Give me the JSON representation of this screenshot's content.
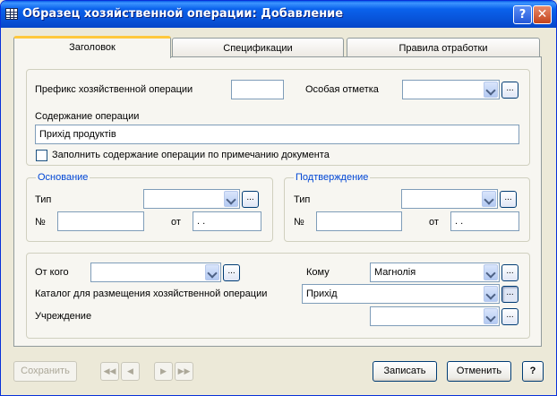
{
  "window": {
    "title": "Образец хозяйственной операции: Добавление"
  },
  "tabs": [
    {
      "label": "Заголовок",
      "active": true
    },
    {
      "label": "Спецификации",
      "active": false
    },
    {
      "label": "Правила отработки",
      "active": false
    }
  ],
  "header_section": {
    "prefix_label": "Префикс хозяйственной операции",
    "prefix_value": "",
    "special_mark_label": "Особая отметка",
    "special_mark_value": "",
    "content_label": "Содержание операции",
    "content_value": "Прихід продуктів",
    "fill_checkbox_label": "Заполнить содержание операции по примечанию документа",
    "fill_checkbox_checked": false
  },
  "basis": {
    "title": "Основание",
    "type_label": "Тип",
    "type_value": "",
    "number_label": "№",
    "number_value": "",
    "date_label": "от",
    "date_value": " . ."
  },
  "confirmation": {
    "title": "Подтверждение",
    "type_label": "Тип",
    "type_value": "",
    "number_label": "№",
    "number_value": "",
    "date_label": "от",
    "date_value": " . ."
  },
  "parties": {
    "from_label": "От кого",
    "from_value": "",
    "to_label": "Кому",
    "to_value": "Магнолія",
    "catalog_label": "Каталог для размещения хозяйственной операции",
    "catalog_value": "Прихід",
    "institution_label": "Учреждение",
    "institution_value": ""
  },
  "footer": {
    "save_label": "Сохранить",
    "nav_first": "◀◀",
    "nav_prev": "◀",
    "nav_next": "▶",
    "nav_last": "▶▶",
    "write_label": "Записать",
    "cancel_label": "Отменить",
    "help_label": "?"
  },
  "icons": {
    "dots": "...",
    "help": "?",
    "close": "✕"
  },
  "colors": {
    "titlebar": "#0a5fe8",
    "accent_tab": "#ffc83c",
    "group_title": "#0046d5"
  }
}
